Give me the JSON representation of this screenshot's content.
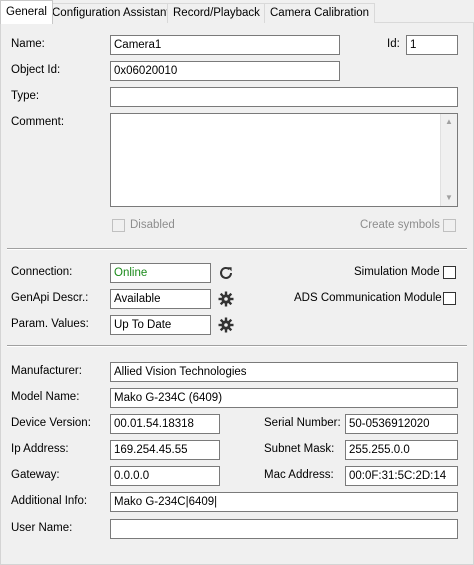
{
  "tabs": [
    "General",
    "Configuration Assistant",
    "Record/Playback",
    "Camera Calibration"
  ],
  "general": {
    "name_label": "Name:",
    "name_value": "Camera1",
    "id_label": "Id:",
    "id_value": "1",
    "object_id_label": "Object Id:",
    "object_id_value": "0x06020010",
    "type_label": "Type:",
    "type_value": "",
    "comment_label": "Comment:",
    "comment_value": "",
    "disabled_label": "Disabled",
    "create_symbols_label": "Create symbols"
  },
  "status": {
    "connection_label": "Connection:",
    "connection_value": "Online",
    "genapi_label": "GenApi Descr.:",
    "genapi_value": "Available",
    "param_label": "Param. Values:",
    "param_value": "Up To Date",
    "simulation_label": "Simulation Mode",
    "ads_label": "ADS Communication Module"
  },
  "device": {
    "manufacturer_label": "Manufacturer:",
    "manufacturer_value": "Allied Vision Technologies",
    "model_label": "Model Name:",
    "model_value": "Mako G-234C (6409)",
    "version_label": "Device Version:",
    "version_value": "00.01.54.18318",
    "serial_label": "Serial Number:",
    "serial_value": "50-0536912020",
    "ip_label": "Ip Address:",
    "ip_value": "169.254.45.55",
    "subnet_label": "Subnet Mask:",
    "subnet_value": "255.255.0.0",
    "gateway_label": "Gateway:",
    "gateway_value": "0.0.0.0",
    "mac_label": "Mac Address:",
    "mac_value": "00:0F:31:5C:2D:14",
    "additional_label": "Additional Info:",
    "additional_value": "Mako G-234C|6409|",
    "username_label": "User Name:",
    "username_value": ""
  },
  "colors": {
    "online": "#1a8a1a",
    "panel": "#f0f0f0",
    "field_border": "#7a7a7a"
  },
  "icons": {
    "refresh": "refresh-icon",
    "gear": "gear-icon"
  }
}
